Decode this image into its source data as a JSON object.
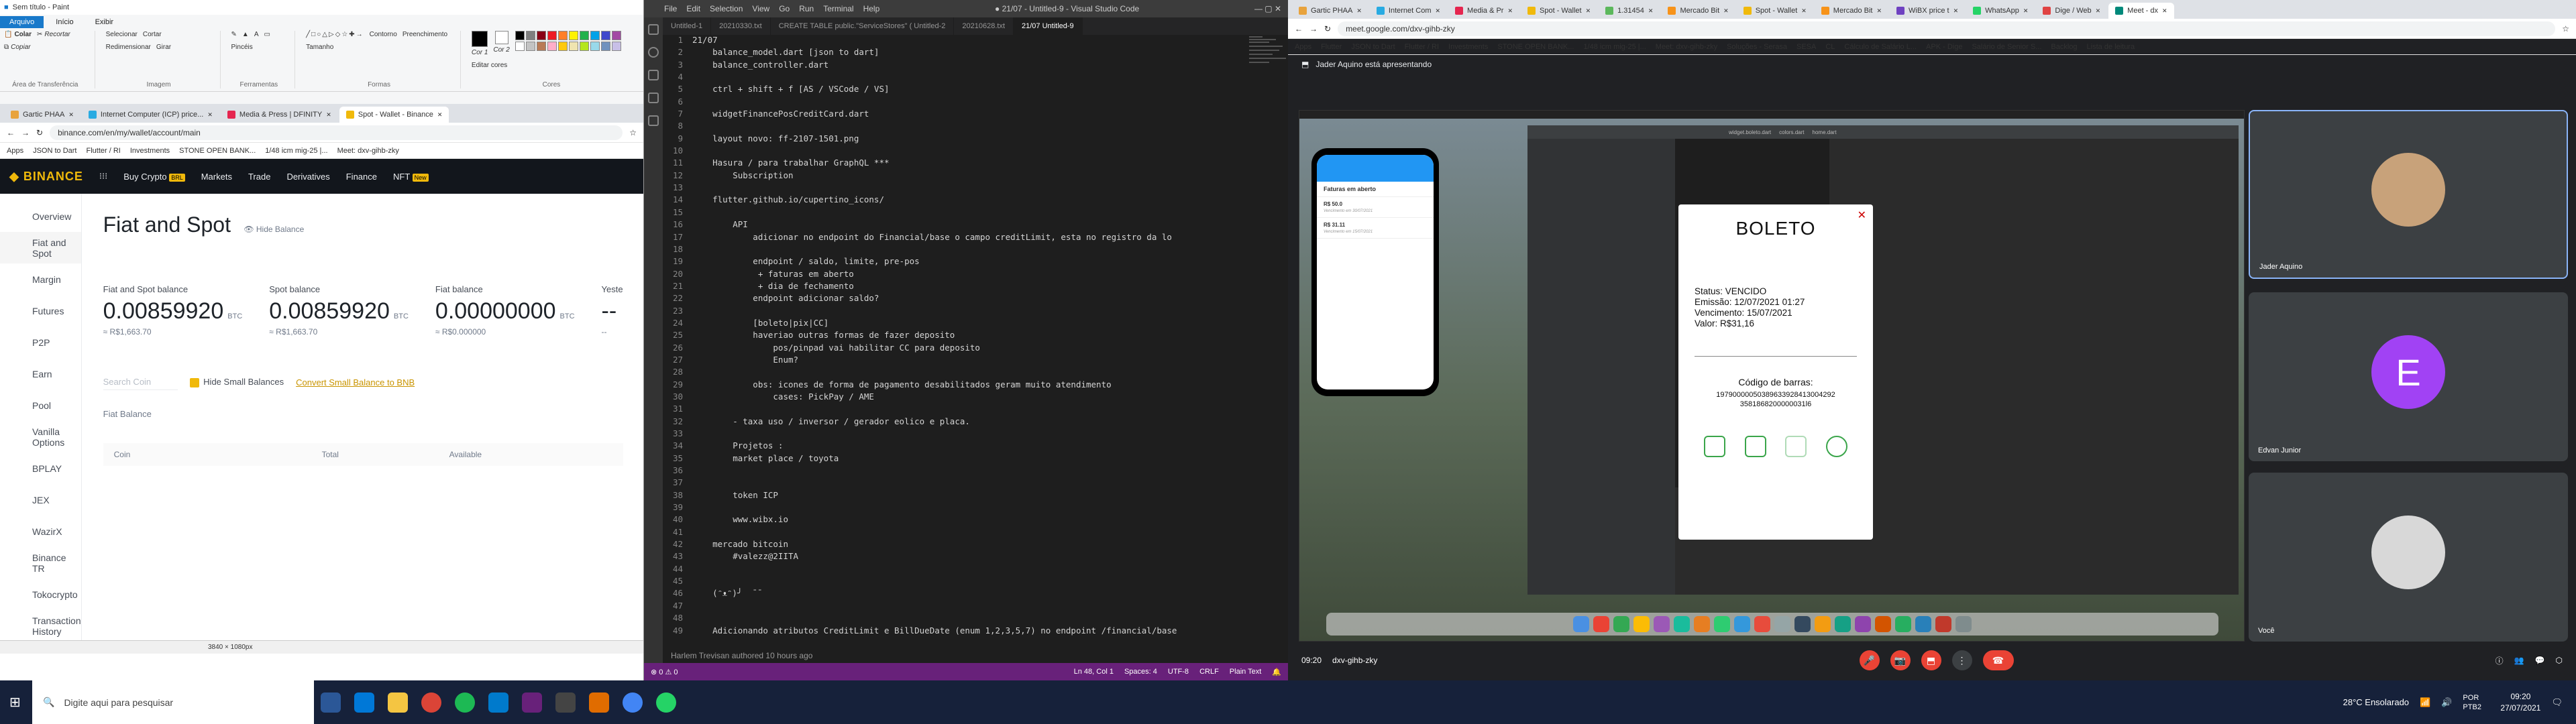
{
  "paint": {
    "title": "Sem título - Paint",
    "tabs": [
      "Arquivo",
      "Início",
      "Exibir"
    ],
    "clipboard": [
      "Colar",
      "Recortar",
      "Copiar"
    ],
    "image": [
      "Selecionar",
      "Cortar",
      "Redimensionar",
      "Girar"
    ],
    "groups": [
      "Área de Transferência",
      "Imagem",
      "Ferramentas",
      "Formas",
      "Cores"
    ],
    "tools_label": "Pincéis",
    "shape_opts": [
      "Contorno",
      "Preenchimento"
    ],
    "size_label": "Tamanho",
    "color1": "Cor 1",
    "color2": "Cor 2",
    "edit_colors": "Editar cores",
    "status_size": "3840 × 1080px"
  },
  "binance_browser": {
    "tabs": [
      {
        "label": "Gartic PHAA",
        "color": "#e8a33d"
      },
      {
        "label": "Internet Computer (ICP) price...",
        "color": "#29abe2"
      },
      {
        "label": "Media & Press | DFINITY",
        "color": "#e5254f"
      },
      {
        "label": "Spot - Wallet - Binance",
        "color": "#f0b90b",
        "active": true
      }
    ],
    "url": "binance.com/en/my/wallet/account/main",
    "bookmarks": [
      "Apps",
      "JSON to Dart",
      "Flutter / RI",
      "Investments",
      "STONE OPEN BANK...",
      "1/48 icm mig-25 |...",
      "Meet: dxv-gihb-zky"
    ],
    "nav": {
      "buy_crypto": "Buy Crypto",
      "buy_badge": "BRL",
      "markets": "Markets",
      "trade": "Trade",
      "derivatives": "Derivatives",
      "finance": "Finance",
      "nft": "NFT",
      "nft_badge": "New"
    },
    "sidebar": [
      "Overview",
      "Fiat and Spot",
      "Margin",
      "Futures",
      "P2P",
      "Earn",
      "Pool",
      "Vanilla Options",
      "BPLAY",
      "JEX",
      "WazirX",
      "Binance TR",
      "Tokocrypto",
      "Transaction History"
    ],
    "heading": "Fiat and Spot",
    "hide_balance": "Hide Balance",
    "balances": [
      {
        "label": "Fiat and Spot balance",
        "value": "0.00859920",
        "unit": "BTC",
        "fiat": "≈ R$1,663.70"
      },
      {
        "label": "Spot balance",
        "value": "0.00859920",
        "unit": "BTC",
        "fiat": "≈ R$1,663.70"
      },
      {
        "label": "Fiat balance",
        "value": "0.00000000",
        "unit": "BTC",
        "fiat": "≈ R$0.000000"
      },
      {
        "label": "Yeste",
        "value": "--",
        "unit": "",
        "fiat": "--"
      }
    ],
    "search_placeholder": "Search Coin",
    "hide_small": "Hide Small Balances",
    "convert_small": "Convert Small Balance to BNB",
    "fiat_balance_label": "Fiat Balance",
    "table_headers": [
      "Coin",
      "Total",
      "Available"
    ]
  },
  "vscode": {
    "menu": [
      "File",
      "Edit",
      "Selection",
      "View",
      "Go",
      "Run",
      "Terminal",
      "Help"
    ],
    "title": "● 21/07 - Untitled-9 - Visual Studio Code",
    "tabs": [
      "Untitled-1",
      "20210330.txt",
      "CREATE TABLE public.\"ServiceStores\" (   Untitled-2",
      "20210628.txt",
      "21/07   Untitled-9"
    ],
    "lines": [
      "21/07",
      "    balance_model.dart [json to dart]",
      "    balance_controller.dart",
      "",
      "    ctrl + shift + f [AS / VSCode / VS]",
      "",
      "    widgetFinancePosCreditCard.dart",
      "",
      "    layout novo: ff-2107-1501.png",
      "",
      "    Hasura / para trabalhar GraphQL ***",
      "        Subscription",
      "",
      "    flutter.github.io/cupertino_icons/",
      "",
      "        API",
      "            adicionar no endpoint do Financial/base o campo creditLimit, esta no registro da lo",
      "",
      "            endpoint / saldo, limite, pre-pos",
      "             + faturas em aberto",
      "             + dia de fechamento",
      "            endpoint adicionar saldo?",
      "",
      "            [boleto|pix|CC]",
      "            haveriao outras formas de fazer deposito",
      "                pos/pinpad vai habilitar CC para deposito",
      "                Enum?",
      "",
      "            obs: icones de forma de pagamento desabilitados geram muito atendimento",
      "                cases: PickPay / AME",
      "",
      "        - taxa uso / inversor / gerador eolico e placa.",
      "",
      "        Projetos :",
      "        market place / toyota",
      "",
      "",
      "        token ICP",
      "",
      "        www.wibx.io",
      "",
      "    mercado bitcoin",
      "        #valezz@2IITA",
      "",
      "",
      "    (ᵔᴥᵔ)╯  ̄ ̄",
      "",
      "",
      "    Adicionando atributos CreditLimit e BillDueDate (enum 1,2,3,5,7) no endpoint /financial/base"
    ],
    "blame": "Harlem Trevisan authored 10 hours ago",
    "status": [
      "Ln 48, Col 1",
      "Spaces: 4",
      "UTF-8",
      "CRLF",
      "Plain Text"
    ]
  },
  "meet_browser": {
    "tabs": [
      {
        "label": "Gartic PHAA",
        "color": "#e8a33d"
      },
      {
        "label": "Internet Com",
        "color": "#29abe2"
      },
      {
        "label": "Media & Pr",
        "color": "#e5254f"
      },
      {
        "label": "Spot - Wallet",
        "color": "#f0b90b"
      },
      {
        "label": "1.31454",
        "color": "#5cb85c"
      },
      {
        "label": "Mercado Bit",
        "color": "#f7931a"
      },
      {
        "label": "Spot - Wallet",
        "color": "#f0b90b"
      },
      {
        "label": "Mercado Bit",
        "color": "#f7931a"
      },
      {
        "label": "WiBX price t",
        "color": "#6f42c1"
      },
      {
        "label": "WhatsApp",
        "color": "#25d366"
      },
      {
        "label": "Dige / Web",
        "color": "#e04343"
      },
      {
        "label": "Meet - dx",
        "color": "#00897b",
        "active": true
      }
    ],
    "url": "meet.google.com/dxv-gihb-zky",
    "bookmarks": [
      "Apps",
      "Flutter",
      "JSON to Dart",
      "Flutter / RI",
      "Investments",
      "STONE OPEN BANK...",
      "1/48 icm mig-25 |...",
      "Meet: dxv-gihb-zky",
      "Soluções - Serasa",
      "SESA",
      "CL",
      "Cálculo de Salário L...",
      "APK - Dige",
      "Salário de Senior S...",
      "Backlog",
      "Lista de leitura"
    ],
    "presenting": "Jader Aquino está apresentando",
    "participants": [
      {
        "name": "Jader Aquino",
        "initial": "",
        "color": "#c8a27a"
      },
      {
        "name": "Edvan Junior",
        "initial": "E",
        "color": "#a142f4"
      },
      {
        "name": "Você",
        "initial": "",
        "color": "#d8d8d8"
      }
    ],
    "meeting_time": "09:20",
    "meeting_code": "dxv-gihb-zky"
  },
  "shared_screen": {
    "app_title": "Faturas em aberto",
    "invoices": [
      {
        "amount": "R$ 50.0",
        "date": "Vencimento em 30/07/2021"
      },
      {
        "amount": "R$ 31.11",
        "date": "Vencimento em 15/07/2021"
      }
    ],
    "ide_tabs": [
      "widget.boleto.dart",
      "colors.dart",
      "home.dart"
    ],
    "boleto": {
      "title": "BOLETO",
      "status": "Status: VENCIDO",
      "issue": "Emissão: 12/07/2021     01:27",
      "due": "Vencimento: 15/07/2021",
      "value": "Valor: R$31,16",
      "barcode_label": "Código de barras:",
      "barcode": "19790000050389633928413004292 3581868200000031l6"
    }
  },
  "taskbar": {
    "search": "Digite aqui para pesquisar",
    "weather": "28°C  Ensolarado",
    "lang": "POR PTB2",
    "time": "09:20",
    "date": "27/07/2021"
  }
}
